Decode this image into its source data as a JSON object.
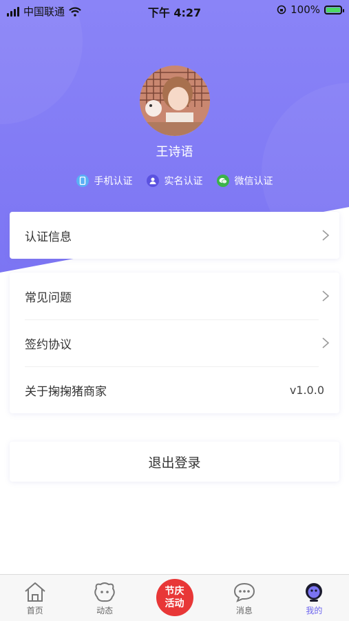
{
  "status_bar": {
    "carrier": "中国联通",
    "time": "下午 4:27",
    "battery": "100%"
  },
  "profile": {
    "name": "王诗语",
    "badges": [
      {
        "label": "手机认证",
        "icon": "phone-icon",
        "color": "#5ab0f5"
      },
      {
        "label": "实名认证",
        "icon": "person-icon",
        "color": "#5b52e0"
      },
      {
        "label": "微信认证",
        "icon": "wechat-icon",
        "color": "#3cb34a"
      }
    ]
  },
  "menu": {
    "verification": "认证信息",
    "faq": "常见问题",
    "agreement": "签约协议",
    "about": "关于掬掬猪商家",
    "version": "v1.0.0"
  },
  "logout_label": "退出登录",
  "tabbar": {
    "home": "首页",
    "moments": "动态",
    "promo_line1": "节庆",
    "promo_line2": "活动",
    "messages": "消息",
    "mine": "我的"
  },
  "colors": {
    "accent": "#7b74f3",
    "promo": "#e83737"
  }
}
